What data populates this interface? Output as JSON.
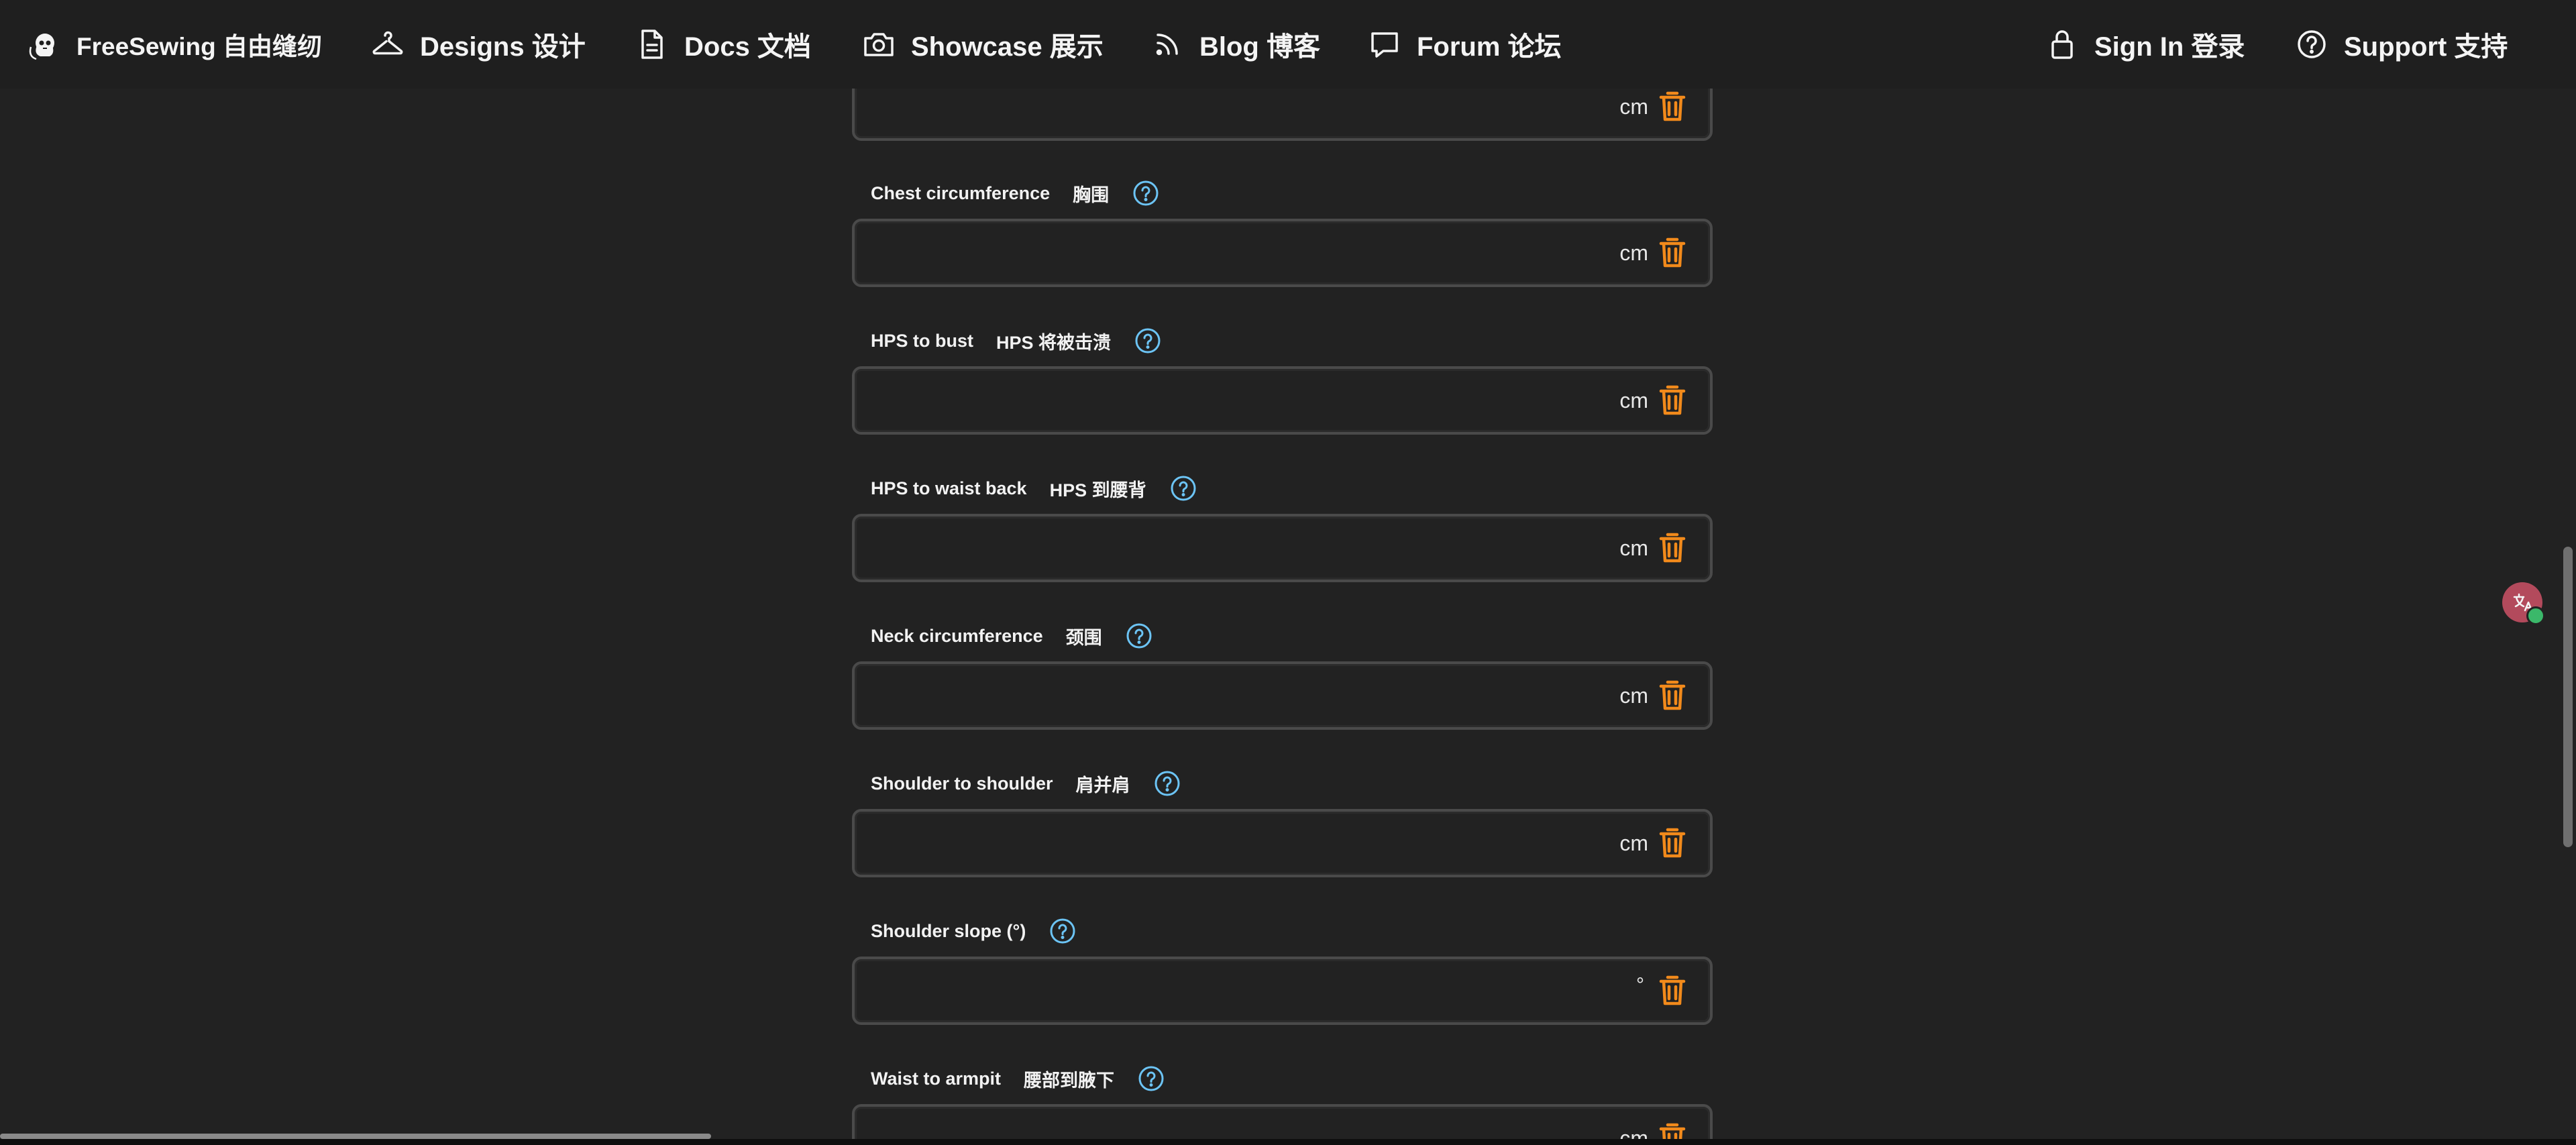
{
  "nav": {
    "brand": "FreeSewing 自由缝纫",
    "designs": "Designs 设计",
    "docs": "Docs 文档",
    "showcase": "Showcase 展示",
    "blog": "Blog 博客",
    "forum": "Forum 论坛",
    "signin": "Sign In 登录",
    "support": "Support 支持"
  },
  "fields": [
    {
      "label": "",
      "label_zh": "",
      "unit": "cm",
      "value": ""
    },
    {
      "label": "Chest circumference",
      "label_zh": "胸围",
      "unit": "cm",
      "value": ""
    },
    {
      "label": "HPS to bust",
      "label_zh": "HPS 将被击溃",
      "unit": "cm",
      "value": ""
    },
    {
      "label": "HPS to waist back",
      "label_zh": "HPS 到腰背",
      "unit": "cm",
      "value": ""
    },
    {
      "label": "Neck circumference",
      "label_zh": "颈围",
      "unit": "cm",
      "value": ""
    },
    {
      "label": "Shoulder to shoulder",
      "label_zh": "肩并肩",
      "unit": "cm",
      "value": ""
    },
    {
      "label": "Shoulder slope (°)",
      "label_zh": "",
      "unit": "°",
      "value": ""
    },
    {
      "label": "Waist to armpit",
      "label_zh": "腰部到腋下",
      "unit": "cm",
      "value": ""
    }
  ],
  "colors": {
    "background": "#222222",
    "trash": "#f28a1b",
    "help": "#6cc4f5",
    "input_border": "#4a4a4a"
  }
}
